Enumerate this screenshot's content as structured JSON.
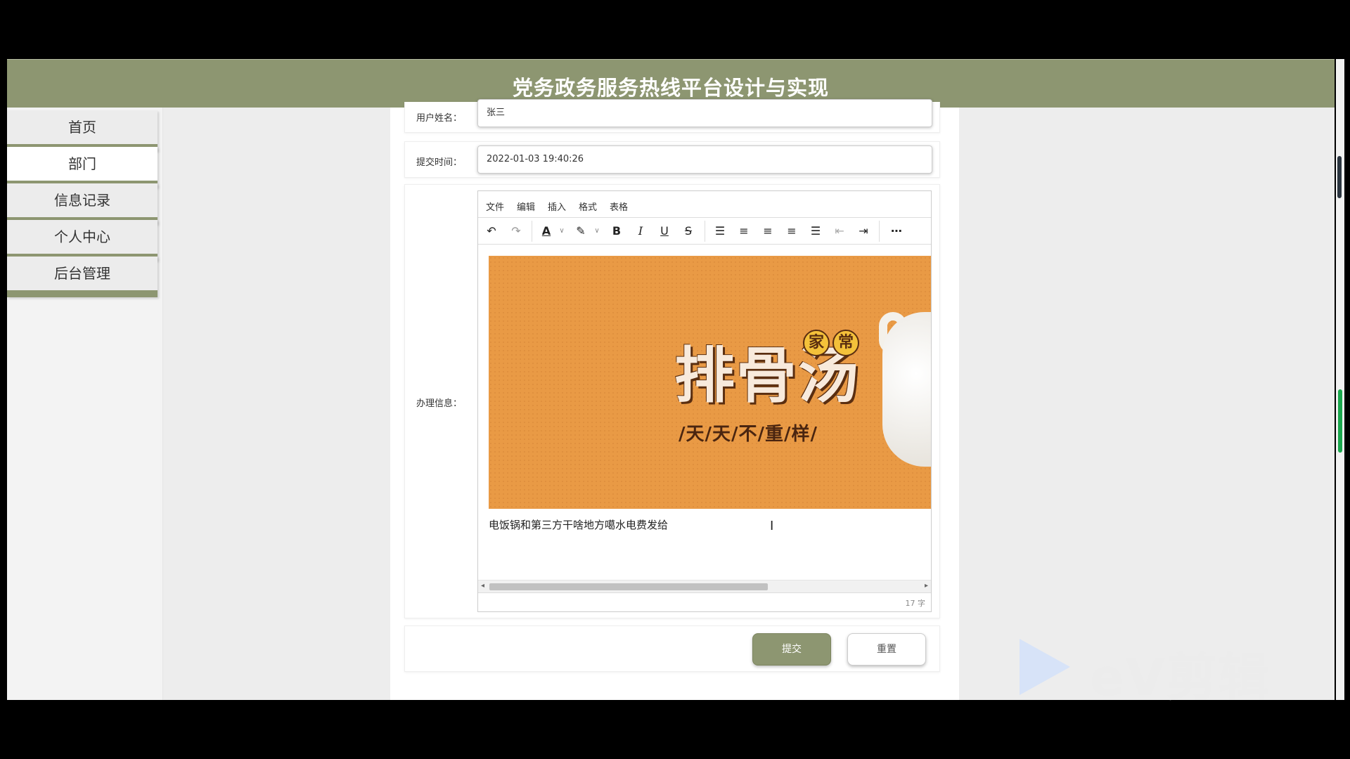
{
  "header": {
    "title": "党务政务服务热线平台设计与实现"
  },
  "sidebar": {
    "items": [
      {
        "label": "首页"
      },
      {
        "label": "部门"
      },
      {
        "label": "信息记录"
      },
      {
        "label": "个人中心"
      },
      {
        "label": "后台管理"
      }
    ],
    "active_index": 1
  },
  "form": {
    "username": {
      "label": "用户姓名：",
      "value": "张三"
    },
    "submit_time": {
      "label": "提交时间：",
      "value": "2022-01-03 19:40:26"
    },
    "handling_info": {
      "label": "办理信息：",
      "editor": {
        "menubar": [
          "文件",
          "编辑",
          "插入",
          "格式",
          "表格"
        ],
        "toolbar": [
          "undo-icon",
          "redo-icon",
          "text-color-icon",
          "highlight-icon",
          "bold-icon",
          "italic-icon",
          "underline-icon",
          "strikethrough-icon",
          "line-height-icon",
          "align-left-icon",
          "align-center-icon",
          "align-right-icon",
          "align-justify-icon",
          "outdent-icon",
          "indent-icon",
          "more-icon"
        ],
        "image": {
          "title": "排骨汤",
          "badge": [
            "家",
            "常"
          ],
          "subtitle": "/天/天/不/重/样/"
        },
        "text": "电饭锅和第三方干啥地方噶水电费发给",
        "word_count": "17 字"
      }
    }
  },
  "buttons": {
    "submit": "提交",
    "reset": "重置"
  },
  "watermark": {
    "text": "eV剪辑"
  },
  "colors": {
    "accent": "#8d9671",
    "banner": "#e99a45"
  }
}
